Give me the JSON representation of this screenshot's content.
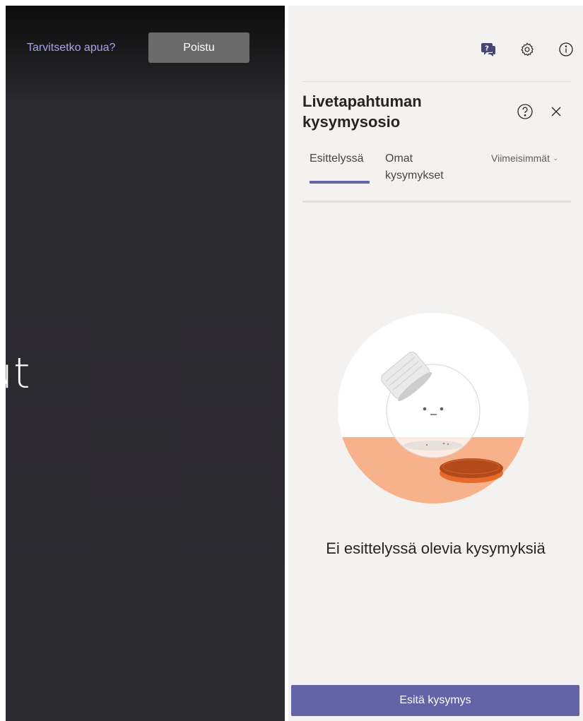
{
  "stage": {
    "help_link": "Tarvitsetko apua?",
    "exit_label": "Poistu",
    "visible_text": "ut"
  },
  "toolbar": {
    "icons": [
      "qna-icon",
      "gear-icon",
      "info-icon"
    ]
  },
  "panel": {
    "title_line1": "Livetapahtuman",
    "title_line2": "kysymysosio",
    "tabs": [
      {
        "label": "Esittelyssä",
        "selected": true
      },
      {
        "label_line1": "Omat",
        "label_line2": "kysymykset",
        "selected": false
      }
    ],
    "sort_label": "Viimeisimmät",
    "empty_message": "Ei esittelyssä olevia kysymyksiä",
    "ask_button": "Esitä kysymys"
  },
  "colors": {
    "accent": "#6264a7",
    "help_link": "#a7a3ee",
    "panel_bg": "#f3f2f1",
    "stage_bg": "#2c2b30"
  }
}
